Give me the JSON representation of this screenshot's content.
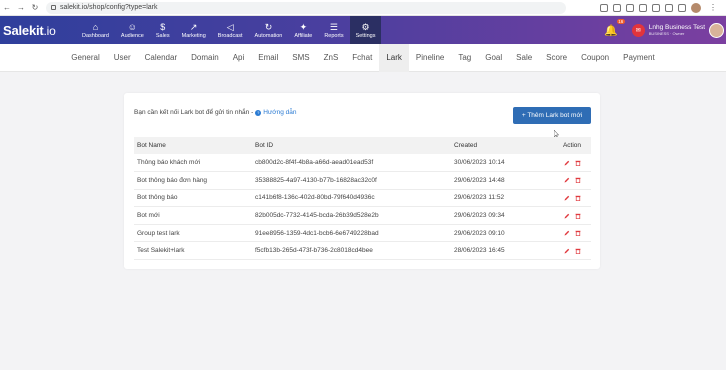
{
  "browser": {
    "url": "salekit.io/shop/config?type=lark"
  },
  "brand": {
    "name": "Salekit",
    "suffix": ".io",
    "header_gradient": [
      "#2f3f9c",
      "#7b3fa0"
    ],
    "accent": "#2f6db5"
  },
  "menu": [
    {
      "label": "Dashboard",
      "icon": "home-icon"
    },
    {
      "label": "Audience",
      "icon": "users-icon"
    },
    {
      "label": "Sales",
      "icon": "dollar-icon"
    },
    {
      "label": "Marketing",
      "icon": "chart-icon"
    },
    {
      "label": "Broadcast",
      "icon": "megaphone-icon"
    },
    {
      "label": "Automation",
      "icon": "automation-icon"
    },
    {
      "label": "Affiliate",
      "icon": "network-icon"
    },
    {
      "label": "Reports",
      "icon": "reports-icon"
    },
    {
      "label": "Settings",
      "icon": "gear-icon",
      "active": true
    }
  ],
  "header": {
    "notification_count": "16",
    "business_name": "Lnhg Business Test",
    "business_sub": "BUSINESS · Owner"
  },
  "tabs": [
    "General",
    "User",
    "Calendar",
    "Domain",
    "Api",
    "Email",
    "SMS",
    "ZnS",
    "Fchat",
    "Lark",
    "Pineline",
    "Tag",
    "Goal",
    "Sale",
    "Score",
    "Coupon",
    "Payment"
  ],
  "active_tab": "Lark",
  "notice": {
    "text": "Bạn cần kết nối Lark bot để gửi tin nhắn -",
    "guide_label": "Hướng dẫn"
  },
  "add_button": "+ Thêm Lark bot mới",
  "table": {
    "headers": [
      "Bot Name",
      "Bot ID",
      "Created",
      "Action"
    ],
    "rows": [
      [
        "Thông báo khách mới",
        "cb800d2c-8f4f-4b8a-a66d-aead01ead53f",
        "30/06/2023 10:14"
      ],
      [
        "Bot thông báo đơn hàng",
        "35388825-4a97-4130-b77b-16828ac32c0f",
        "29/06/2023 14:48"
      ],
      [
        "Bot thông báo",
        "c141b6f8-136c-402d-80bd-79f640d4936c",
        "29/06/2023 11:52"
      ],
      [
        "Bot mới",
        "82b005dc-7732-4145-bcda-26b39d528e2b",
        "29/06/2023 09:34"
      ],
      [
        "Group test lark",
        "91ee8956-1359-4dc1-bcb6-6e6749228bad",
        "29/06/2023 09:10"
      ],
      [
        "Test Salekit+lark",
        "f5cfb13b-265d-473f-b736-2c8018cd4bee",
        "28/06/2023 16:45"
      ]
    ]
  }
}
